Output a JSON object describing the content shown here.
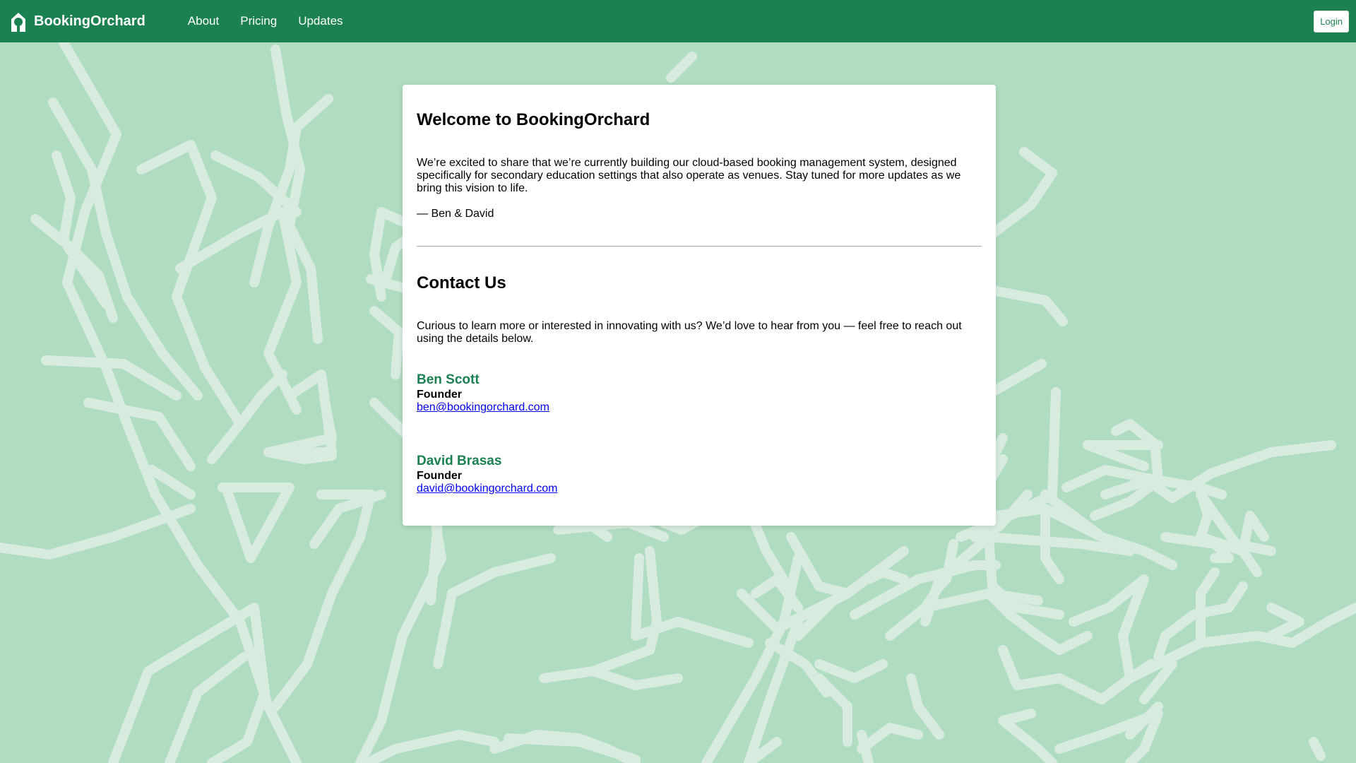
{
  "nav": {
    "brand": "BookingOrchard",
    "links": [
      "About",
      "Pricing",
      "Updates"
    ],
    "login": "Login"
  },
  "welcome": {
    "title": "Welcome to BookingOrchard",
    "body": "We’re excited to share that we’re currently building our cloud-based booking management system, designed specifically for secondary education settings that also operate as venues. Stay tuned for more updates as we bring this vision to life.",
    "signature": "— Ben & David"
  },
  "contact": {
    "title": "Contact Us",
    "intro": "Curious to learn more or interested in innovating with us? We’d love to hear from you — feel free to reach out using the details below.",
    "people": [
      {
        "name": "Ben Scott",
        "role": "Founder",
        "email": "ben@bookingorchard.com"
      },
      {
        "name": "David Brasas",
        "role": "Founder",
        "email": "david@bookingorchard.com"
      }
    ]
  },
  "colors": {
    "brand": "#1b8150",
    "background": "#b0dcc1",
    "branches": "#d7ecdf",
    "link": "#0000ee"
  }
}
